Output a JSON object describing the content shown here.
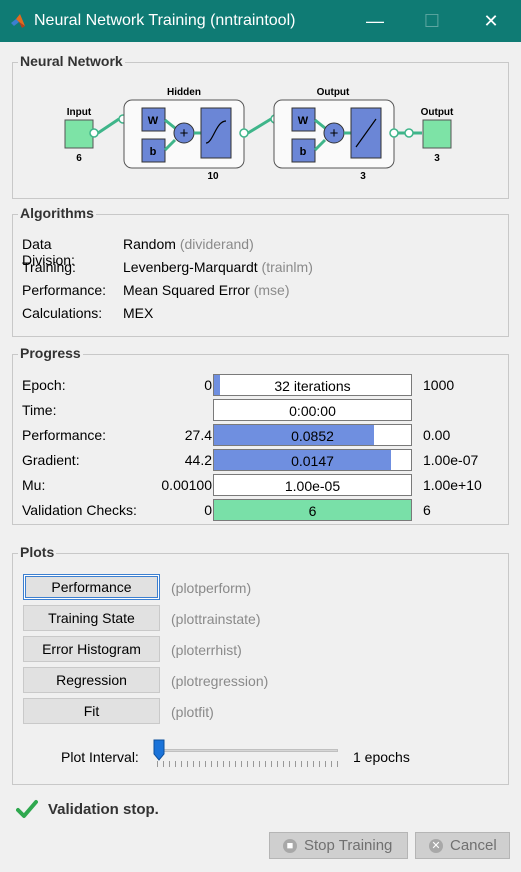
{
  "window": {
    "title": "Neural Network Training (nntraintool)",
    "titlebar_color": "#0f7b74",
    "controls": {
      "minimize": "—",
      "maximize": "☐",
      "close": "✕"
    }
  },
  "network": {
    "section_title": "Neural Network",
    "input_label": "Input",
    "input_size": "6",
    "hidden_label": "Hidden",
    "hidden_size": "10",
    "output_layer_label": "Output",
    "output_layer_size": "3",
    "output_label": "Output",
    "output_size": "3",
    "weight_label": "W",
    "bias_label": "b",
    "colors": {
      "node": "#7de3a6",
      "block": "#6b86d6",
      "link": "#3fb58a"
    }
  },
  "algorithms": {
    "section_title": "Algorithms",
    "rows": [
      {
        "key": "Data Division:",
        "value": "Random",
        "fn": "(dividerand)"
      },
      {
        "key": "Training:",
        "value": "Levenberg-Marquardt",
        "fn": "(trainlm)"
      },
      {
        "key": "Performance:",
        "value": "Mean Squared Error",
        "fn": "(mse)"
      },
      {
        "key": "Calculations:",
        "value": "MEX",
        "fn": ""
      }
    ]
  },
  "progress": {
    "section_title": "Progress",
    "rows": [
      {
        "key": "Epoch:",
        "start": "0",
        "bar_text": "32 iterations",
        "end": "1000",
        "fill": 0.032,
        "color": "#6f8fe0"
      },
      {
        "key": "Time:",
        "start": "",
        "bar_text": "0:00:00",
        "end": "",
        "fill": 0,
        "color": "#6f8fe0"
      },
      {
        "key": "Performance:",
        "start": "27.4",
        "bar_text": "0.0852",
        "end": "0.00",
        "fill": 0.81,
        "color": "#6f8fe0"
      },
      {
        "key": "Gradient:",
        "start": "44.2",
        "bar_text": "0.0147",
        "end": "1.00e-07",
        "fill": 0.9,
        "color": "#6f8fe0"
      },
      {
        "key": "Mu:",
        "start": "0.00100",
        "bar_text": "1.00e-05",
        "end": "1.00e+10",
        "fill": 0,
        "color": "#6f8fe0"
      },
      {
        "key": "Validation Checks:",
        "start": "0",
        "bar_text": "6",
        "end": "6",
        "fill": 1.0,
        "color": "#79e0a8"
      }
    ]
  },
  "plots": {
    "section_title": "Plots",
    "buttons": [
      {
        "label": "Performance",
        "fn": "(plotperform)"
      },
      {
        "label": "Training State",
        "fn": "(plottrainstate)"
      },
      {
        "label": "Error Histogram",
        "fn": "(ploterrhist)"
      },
      {
        "label": "Regression",
        "fn": "(plotregression)"
      },
      {
        "label": "Fit",
        "fn": "(plotfit)"
      }
    ],
    "interval_label": "Plot Interval:",
    "interval_value": "1 epochs",
    "interval_position": 0
  },
  "status": {
    "text": "Validation stop.",
    "icon": "check-icon",
    "color": "#2fa84f"
  },
  "footer": {
    "stop_label": "Stop Training",
    "cancel_label": "Cancel"
  }
}
